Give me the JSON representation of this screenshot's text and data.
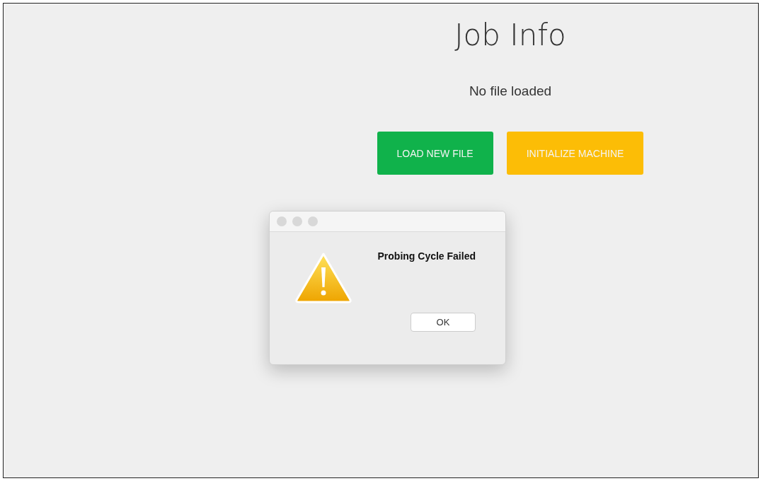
{
  "page": {
    "title": "Job Info",
    "status": "No file loaded"
  },
  "buttons": [
    {
      "label": "LOAD NEW FILE",
      "kind": "primary"
    },
    {
      "label": "INITIALIZE MACHINE",
      "kind": "warning"
    }
  ],
  "dialog": {
    "message": "Probing Cycle Failed",
    "button": "OK"
  }
}
